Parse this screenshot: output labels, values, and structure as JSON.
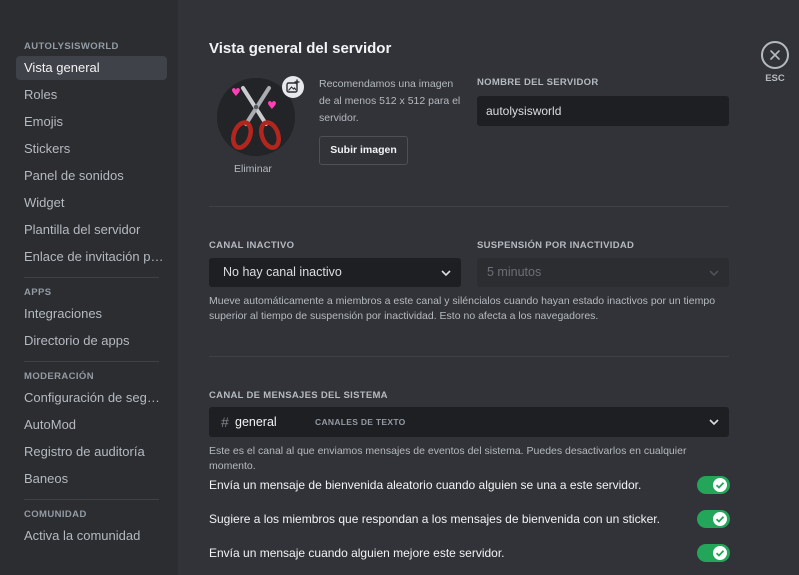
{
  "sidebar": {
    "server_header": "AUTOLYSISWORLD",
    "server_items": [
      {
        "label": "Vista general",
        "active": true
      },
      {
        "label": "Roles"
      },
      {
        "label": "Emojis"
      },
      {
        "label": "Stickers"
      },
      {
        "label": "Panel de sonidos"
      },
      {
        "label": "Widget"
      },
      {
        "label": "Plantilla del servidor"
      },
      {
        "label": "Enlace de invitación pe..."
      }
    ],
    "apps_header": "APPS",
    "apps_items": [
      {
        "label": "Integraciones"
      },
      {
        "label": "Directorio de apps"
      }
    ],
    "moderation_header": "MODERACIÓN",
    "moderation_items": [
      {
        "label": "Configuración de segur..."
      },
      {
        "label": "AutoMod"
      },
      {
        "label": "Registro de auditoría"
      },
      {
        "label": "Baneos"
      }
    ],
    "community_header": "COMUNIDAD",
    "community_items": [
      {
        "label": "Activa la comunidad"
      }
    ]
  },
  "main": {
    "title": "Vista general del servidor",
    "icon": {
      "remove_label": "Eliminar",
      "recommendation": "Recomendamos una imagen de al menos 512 x 512 para el servidor.",
      "upload_button": "Subir imagen",
      "upload_icon": "image-plus-icon"
    },
    "server_name": {
      "label": "NOMBRE DEL SERVIDOR",
      "value": "autolysisworld"
    },
    "inactive": {
      "channel_label": "CANAL INACTIVO",
      "channel_value": "No hay canal inactivo",
      "timeout_label": "SUSPENSIÓN POR INACTIVIDAD",
      "timeout_value": "5 minutos",
      "help": "Mueve automáticamente a miembros a este canal y siléncialos cuando hayan estado inactivos por un tiempo superior al tiempo de suspensión por inactividad. Esto no afecta a los navegadores."
    },
    "system_channel": {
      "label": "CANAL DE MENSAJES DEL SISTEMA",
      "hash": "#",
      "channel": "general",
      "category": "CANALES DE TEXTO",
      "help": "Este es el canal al que enviamos mensajes de eventos del sistema. Puedes desactivarlos en cualquier momento.",
      "toggles": [
        {
          "label": "Envía un mensaje de bienvenida aleatorio cuando alguien se una a este servidor.",
          "on": true
        },
        {
          "label": "Sugiere a los miembros que respondan a los mensajes de bienvenida con un sticker.",
          "on": true
        },
        {
          "label": "Envía un mensaje cuando alguien mejore este servidor.",
          "on": true
        }
      ]
    }
  },
  "close": {
    "label": "ESC",
    "icon": "close-icon"
  },
  "colors": {
    "background": "#313338",
    "sidebar": "#2b2d31",
    "input": "#1e1f22",
    "toggle_on": "#23a55a"
  }
}
